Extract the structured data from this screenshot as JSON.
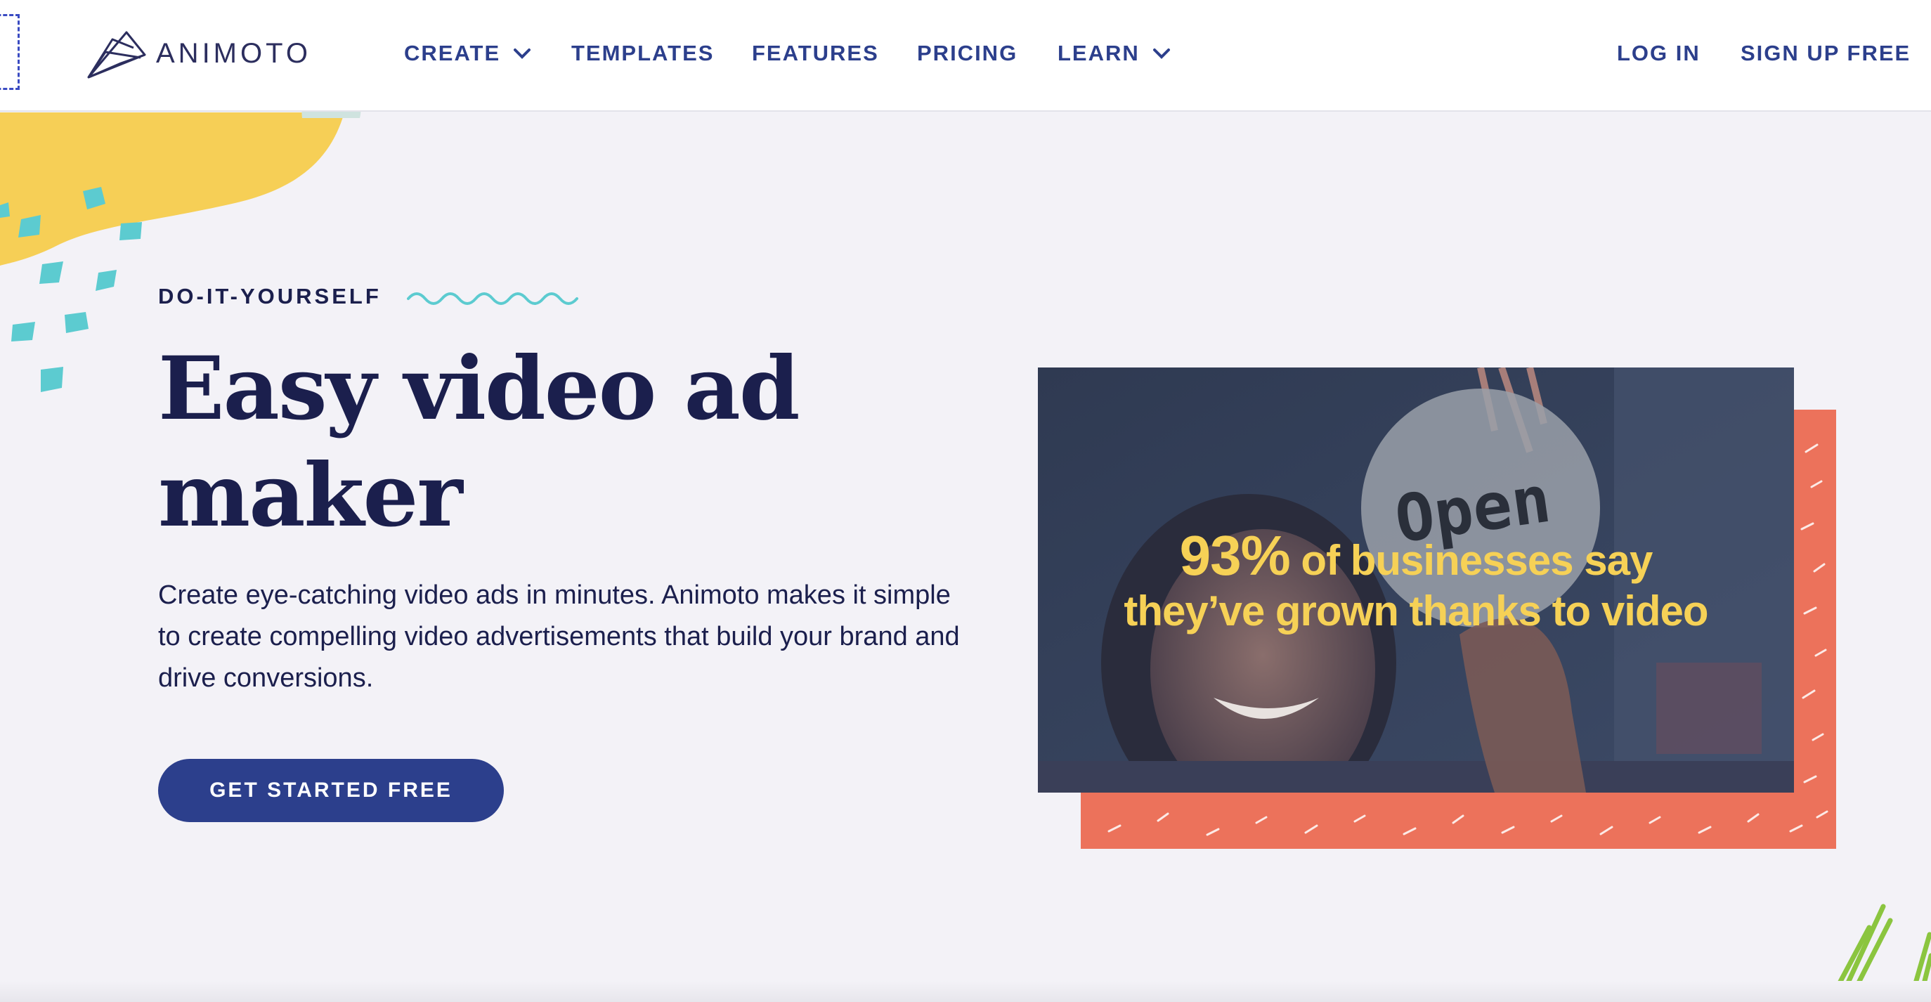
{
  "header": {
    "logo_text": "ANIMOTO",
    "nav": [
      {
        "label": "CREATE",
        "has_dropdown": true
      },
      {
        "label": "TEMPLATES",
        "has_dropdown": false
      },
      {
        "label": "FEATURES",
        "has_dropdown": false
      },
      {
        "label": "PRICING",
        "has_dropdown": false
      },
      {
        "label": "LEARN",
        "has_dropdown": true
      }
    ],
    "login_label": "LOG IN",
    "signup_label": "SIGN UP FREE"
  },
  "hero": {
    "eyebrow": "DO-IT-YOURSELF",
    "headline_line1": "Easy video ad",
    "headline_line2": "maker",
    "description": "Create eye-catching video ads in minutes. Animoto makes it simple to create compelling video advertisements that build your brand and drive conversions.",
    "cta_label": "GET STARTED FREE"
  },
  "media": {
    "sign_text": "Open",
    "overlay_percent": "93%",
    "overlay_line1_rest": " of businesses say",
    "overlay_line2": "they’ve grown thanks to video"
  },
  "colors": {
    "navy": "#2c3f8c",
    "text_dark": "#1b1f4d",
    "yellow_blob": "#f6cf56",
    "teal_dots": "#5ccbd0",
    "pink_dots": "#e8507e",
    "coral": "#ec725b",
    "overlay_yellow": "#f6d156",
    "green_accent": "#8bc53f"
  },
  "icons": {
    "logo": "animoto-logo-icon",
    "dropdown": "chevron-down-icon",
    "squiggle": "wave-line-decoration"
  }
}
